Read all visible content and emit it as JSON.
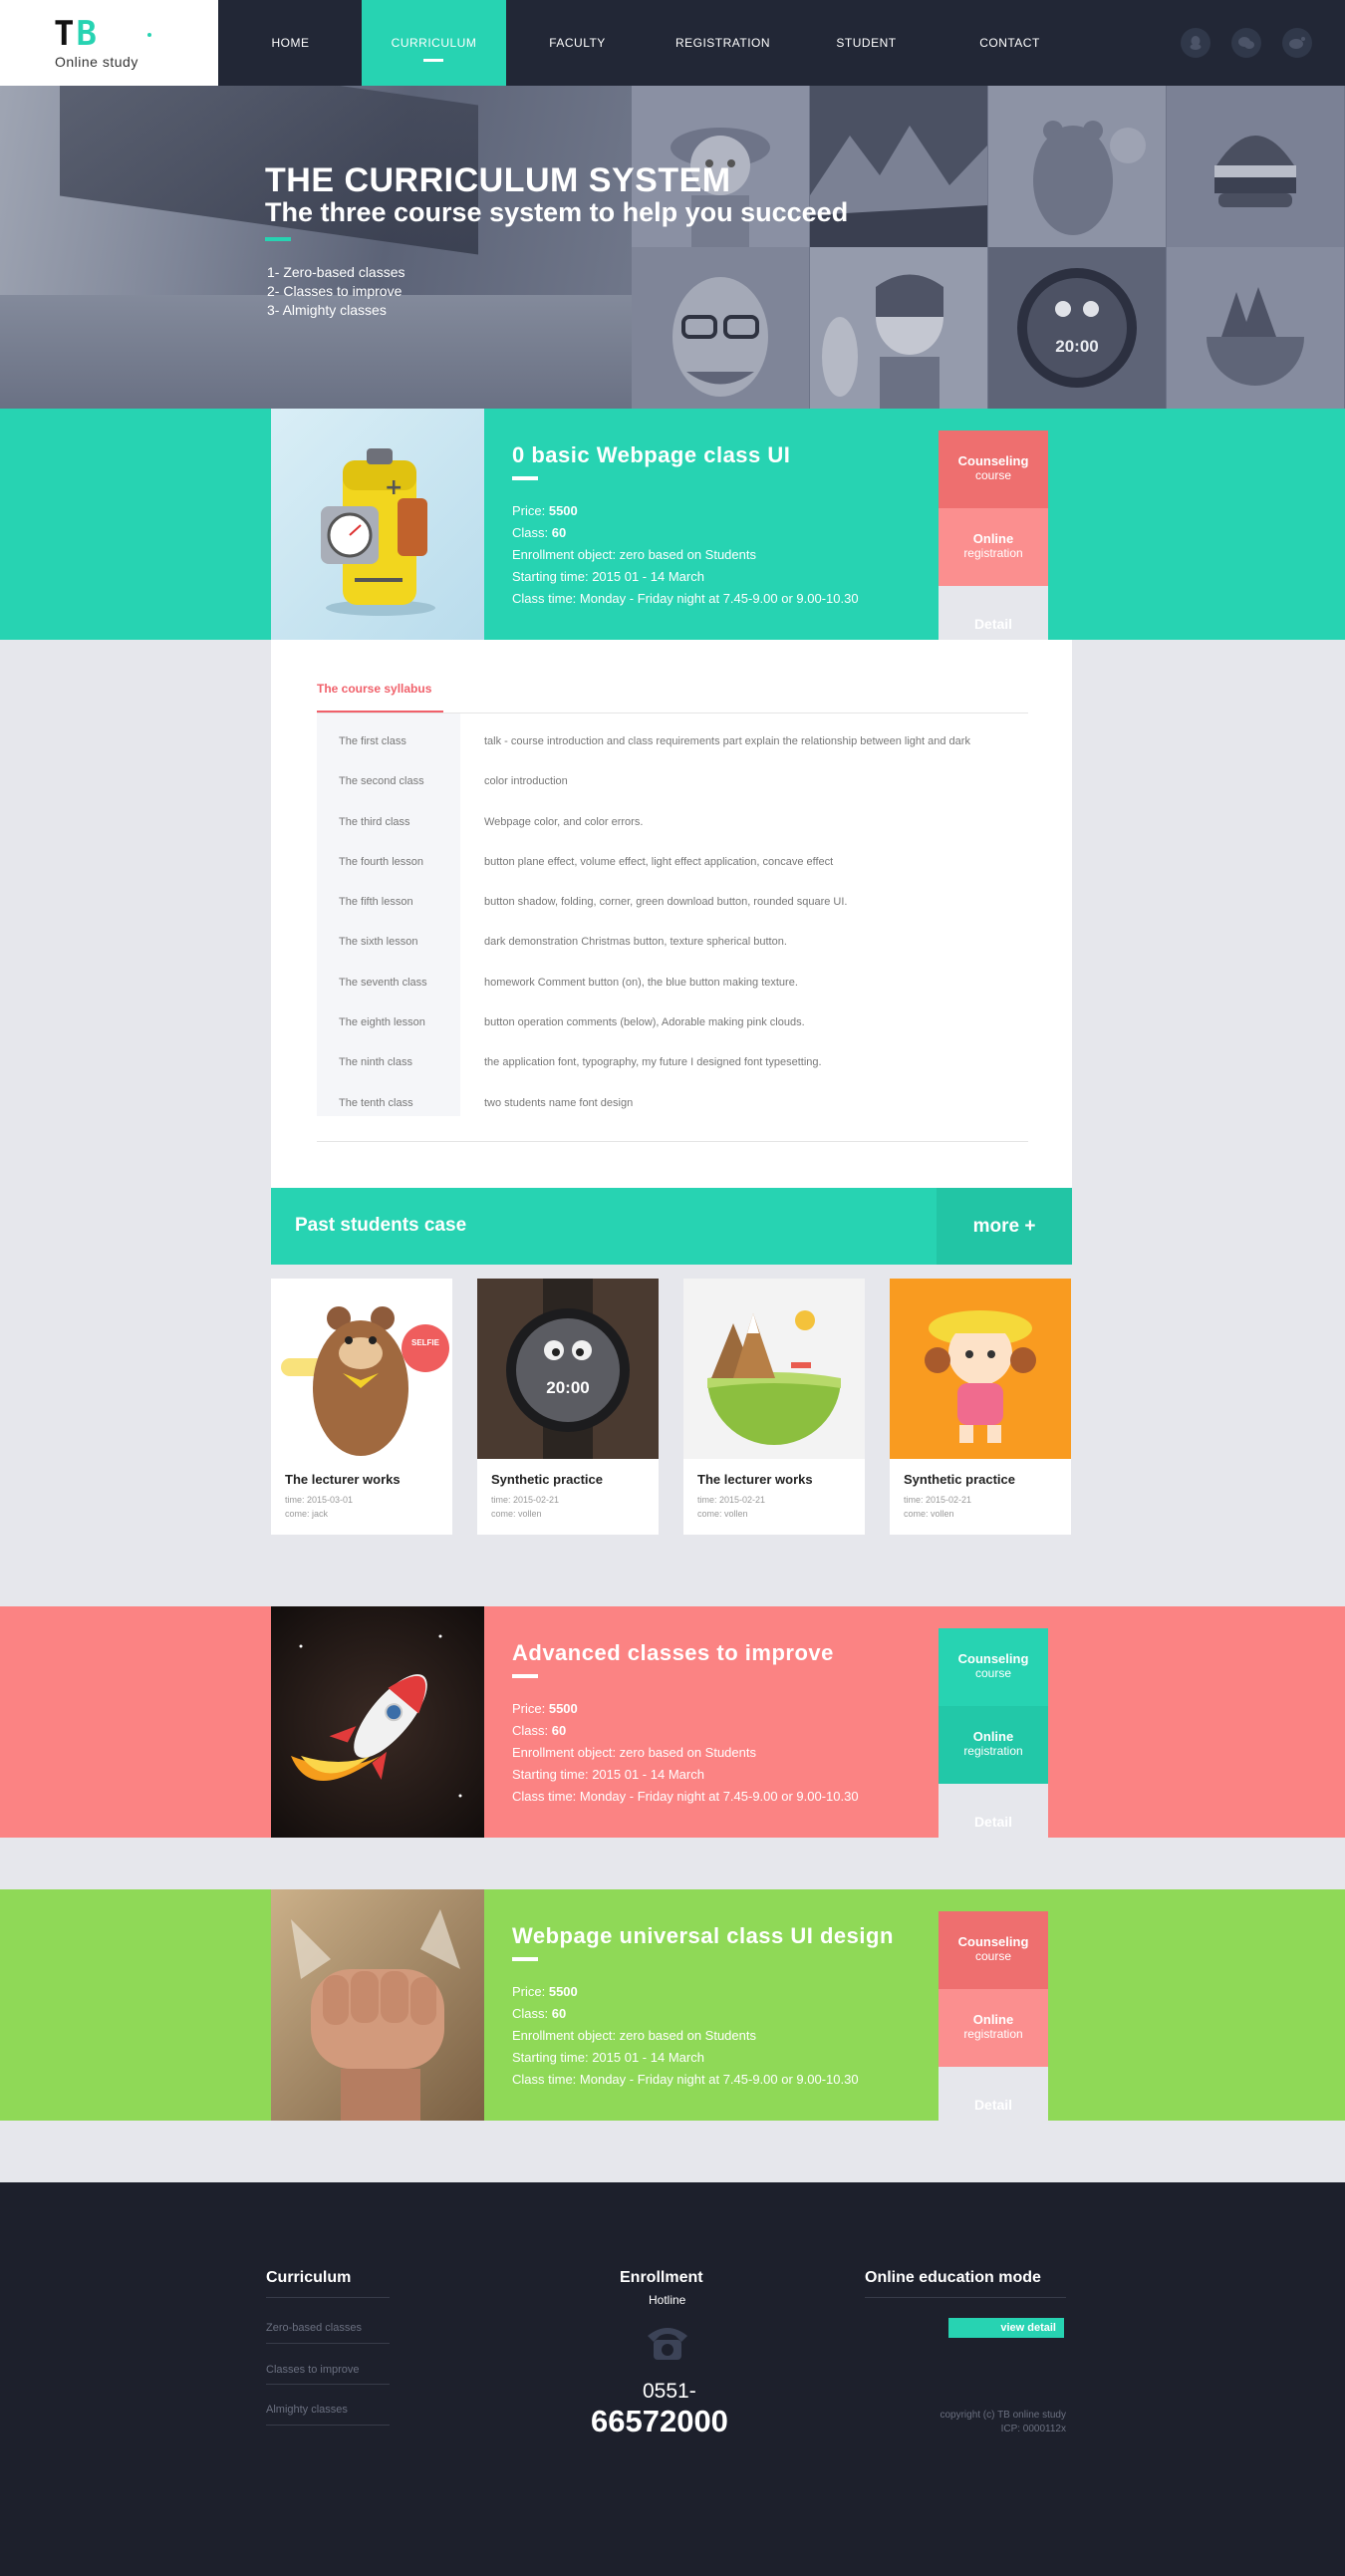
{
  "header": {
    "logo_text": "TB",
    "logo_sub": "Online study",
    "nav": [
      "HOME",
      "CURRICULUM",
      "FACULTY",
      "REGISTRATION",
      "STUDENT",
      "CONTACT"
    ],
    "active_nav": "CURRICULUM",
    "social_icons": [
      "qq-icon",
      "wechat-icon",
      "weibo-icon"
    ]
  },
  "hero": {
    "title": "THE CURRICULUM SYSTEM",
    "subtitle": "The three course system to help you succeed",
    "items": [
      "1- Zero-based classes",
      "2- Classes to improve",
      "3- Almighty classes"
    ],
    "tiles": [
      "cartoon-girl-hat",
      "mountains",
      "bear",
      "burger",
      "man-glasses",
      "girl-puffing",
      "watch-face",
      "island"
    ],
    "watch_time": "20:00"
  },
  "courses": [
    {
      "title": "0 basic Webpage class UI",
      "price_label": "Price: ",
      "price": "5500",
      "class_label": "Class: ",
      "class": "60",
      "enrollment": "Enrollment object: zero based on Students",
      "start": "Starting time: 2015 01 - 14 March",
      "time": "Class time: Monday - Friday night at 7.45-9.00 or 9.00-10.30",
      "counseling_1": "Counseling",
      "counseling_2": "course",
      "online_1": "Online",
      "online_2": "registration",
      "detail": "Detail",
      "band_color": "#27d3b2"
    },
    {
      "title": "Advanced classes to improve",
      "price_label": "Price: ",
      "price": "5500",
      "class_label": "Class: ",
      "class": "60",
      "enrollment": "Enrollment object: zero based on Students",
      "start": "Starting time: 2015 01 - 14 March",
      "time": "Class time: Monday - Friday night at 7.45-9.00 or 9.00-10.30",
      "counseling_1": "Counseling",
      "counseling_2": "course",
      "online_1": "Online",
      "online_2": "registration",
      "detail": "Detail",
      "band_color": "#fb8383"
    },
    {
      "title": "Webpage universal class UI design",
      "price_label": "Price: ",
      "price": "5500",
      "class_label": "Class: ",
      "class": "60",
      "enrollment": "Enrollment object: zero based on Students",
      "start": "Starting time: 2015 01 - 14 March",
      "time": "Class time: Monday - Friday night at 7.45-9.00 or 9.00-10.30",
      "counseling_1": "Counseling",
      "counseling_2": "course",
      "online_1": "Online",
      "online_2": "registration",
      "detail": "Detail",
      "band_color": "#8fd957"
    }
  ],
  "syllabus": {
    "tab": "The course syllabus",
    "rows": [
      [
        "The first class",
        "talk - course introduction and class requirements part explain the relationship between light and dark"
      ],
      [
        "The second class",
        "color introduction"
      ],
      [
        "The third class",
        " Webpage color, and color errors."
      ],
      [
        "The fourth lesson",
        "button plane effect, volume effect, light effect application, concave effect"
      ],
      [
        "The fifth lesson",
        "button shadow, folding, corner, green download button, rounded square UI."
      ],
      [
        "The sixth lesson",
        "dark demonstration Christmas button, texture spherical button."
      ],
      [
        "The seventh class",
        "homework Comment button (on), the blue button making texture."
      ],
      [
        "The eighth lesson",
        " button operation comments (below), Adorable making pink clouds."
      ],
      [
        "The ninth class",
        "the application font, typography, my future I designed font typesetting."
      ],
      [
        "The tenth class",
        " two students name font design"
      ]
    ]
  },
  "past": {
    "title": "Past students case",
    "more": "more +",
    "cards": [
      {
        "title": "The lecturer works",
        "time": "time: 2015-03-01",
        "come": "come: jack",
        "badge": "SELFIE"
      },
      {
        "title": "Synthetic practice",
        "time": "time: 2015-02-21",
        "come": "come: vollen",
        "watch": "20:00"
      },
      {
        "title": "The lecturer works",
        "time": "time: 2015-02-21",
        "come": "come: vollen"
      },
      {
        "title": "Synthetic practice",
        "time": "time: 2015-02-21",
        "come": "come: vollen"
      }
    ]
  },
  "footer": {
    "curriculum_title": "Curriculum",
    "curriculum_links": [
      "Zero-based classes",
      "Classes to improve",
      "Almighty classes"
    ],
    "enrollment_title": "Enrollment",
    "hotline": "Hotline",
    "phone_area": "0551-",
    "phone_number": "66572000",
    "mode_title": "Online education mode",
    "view_detail": "view detail",
    "copyright": "copyright (c) TB online study",
    "icp": "ICP: 0000112x"
  },
  "colors": {
    "teal": "#27d3b2",
    "coral": "#fb8383",
    "green": "#8fd957",
    "dark": "#222736",
    "footer": "#1d202c"
  }
}
